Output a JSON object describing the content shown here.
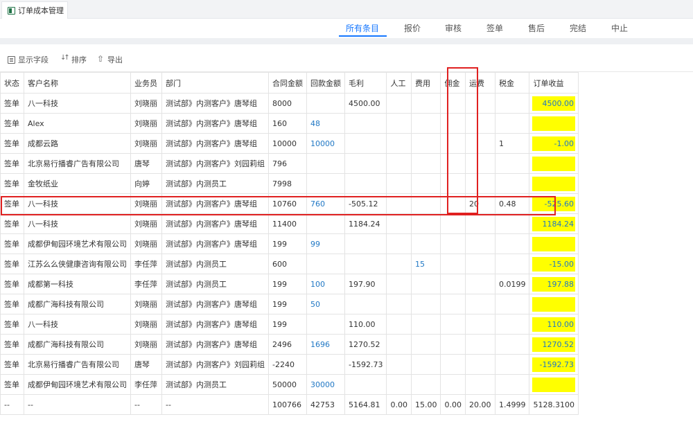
{
  "doc_tab": {
    "label": "订单成本管理",
    "icon": "excel-icon"
  },
  "nav": {
    "items": [
      "所有条目",
      "报价",
      "审核",
      "签单",
      "售后",
      "完结",
      "中止"
    ],
    "active": 0
  },
  "toolbar": {
    "fields_label": "显示字段",
    "sort_label": "排序",
    "export_label": "导出"
  },
  "table": {
    "headers": [
      "状态",
      "客户名称",
      "业务员",
      "部门",
      "合同金额",
      "回款金额",
      "毛利",
      "人工",
      "费用",
      "佣金",
      "运费",
      "税金",
      "订单收益"
    ],
    "rows": [
      [
        "签单",
        "八一科技",
        "刘晓丽",
        "测试部》内测客户》唐琴组",
        "8000",
        "",
        "4500.00",
        "",
        "",
        "",
        "",
        "",
        "4500.00"
      ],
      [
        "签单",
        "Alex",
        "刘晓丽",
        "测试部》内测客户》唐琴组",
        "160",
        "48",
        "",
        "",
        "",
        "",
        "",
        "",
        ""
      ],
      [
        "签单",
        "成都云路",
        "刘晓丽",
        "测试部》内测客户》唐琴组",
        "10000",
        "10000",
        "",
        "",
        "",
        "",
        "",
        "1",
        "-1.00"
      ],
      [
        "签单",
        "北京易行播睿广告有限公司",
        "唐琴",
        "测试部》内测客户》刘园莉组",
        "796",
        "",
        "",
        "",
        "",
        "",
        "",
        "",
        ""
      ],
      [
        "签单",
        "金牧纸业",
        "向婷",
        "测试部》内测员工",
        "7998",
        "",
        "",
        "",
        "",
        "",
        "",
        "",
        ""
      ],
      [
        "签单",
        "八一科技",
        "刘晓丽",
        "测试部》内测客户》唐琴组",
        "10760",
        "760",
        "-505.12",
        "",
        "",
        "",
        "20",
        "0.48",
        "-525.60"
      ],
      [
        "签单",
        "八一科技",
        "刘晓丽",
        "测试部》内测客户》唐琴组",
        "11400",
        "",
        "1184.24",
        "",
        "",
        "",
        "",
        "",
        "1184.24"
      ],
      [
        "签单",
        "成都伊甸园环境艺术有限公司",
        "刘晓丽",
        "测试部》内测客户》唐琴组",
        "199",
        "99",
        "",
        "",
        "",
        "",
        "",
        "",
        ""
      ],
      [
        "签单",
        "江苏么么侠健康咨询有限公司",
        "李任萍",
        "测试部》内测员工",
        "600",
        "",
        "",
        "",
        "15",
        "",
        "",
        "",
        "-15.00"
      ],
      [
        "签单",
        "成都第一科技",
        "李任萍",
        "测试部》内测员工",
        "199",
        "100",
        "197.90",
        "",
        "",
        "",
        "",
        "0.0199",
        "197.88"
      ],
      [
        "签单",
        "成都广海科技有限公司",
        "刘晓丽",
        "测试部》内测客户》唐琴组",
        "199",
        "50",
        "",
        "",
        "",
        "",
        "",
        "",
        ""
      ],
      [
        "签单",
        "八一科技",
        "刘晓丽",
        "测试部》内测客户》唐琴组",
        "199",
        "",
        "110.00",
        "",
        "",
        "",
        "",
        "",
        "110.00"
      ],
      [
        "签单",
        "成都广海科技有限公司",
        "刘晓丽",
        "测试部》内测客户》唐琴组",
        "2496",
        "1696",
        "1270.52",
        "",
        "",
        "",
        "",
        "",
        "1270.52"
      ],
      [
        "签单",
        "北京易行播睿广告有限公司",
        "唐琴",
        "测试部》内测客户》刘园莉组",
        "-2240",
        "",
        "-1592.73",
        "",
        "",
        "",
        "",
        "",
        "-1592.73"
      ],
      [
        "签单",
        "成都伊甸园环境艺术有限公司",
        "李任萍",
        "测试部》内测员工",
        "50000",
        "30000",
        "",
        "",
        "",
        "",
        "",
        "",
        ""
      ]
    ],
    "total": [
      "--",
      "--",
      "--",
      "--",
      "100766",
      "42753",
      "5164.81",
      "0.00",
      "15.00",
      "0.00",
      "20.00",
      "1.4999",
      "5128.3100"
    ]
  },
  "colors": {
    "accent": "#1677ff",
    "link": "#1f77c4",
    "highlight": "#ffff00",
    "annotation": "#e02020"
  }
}
